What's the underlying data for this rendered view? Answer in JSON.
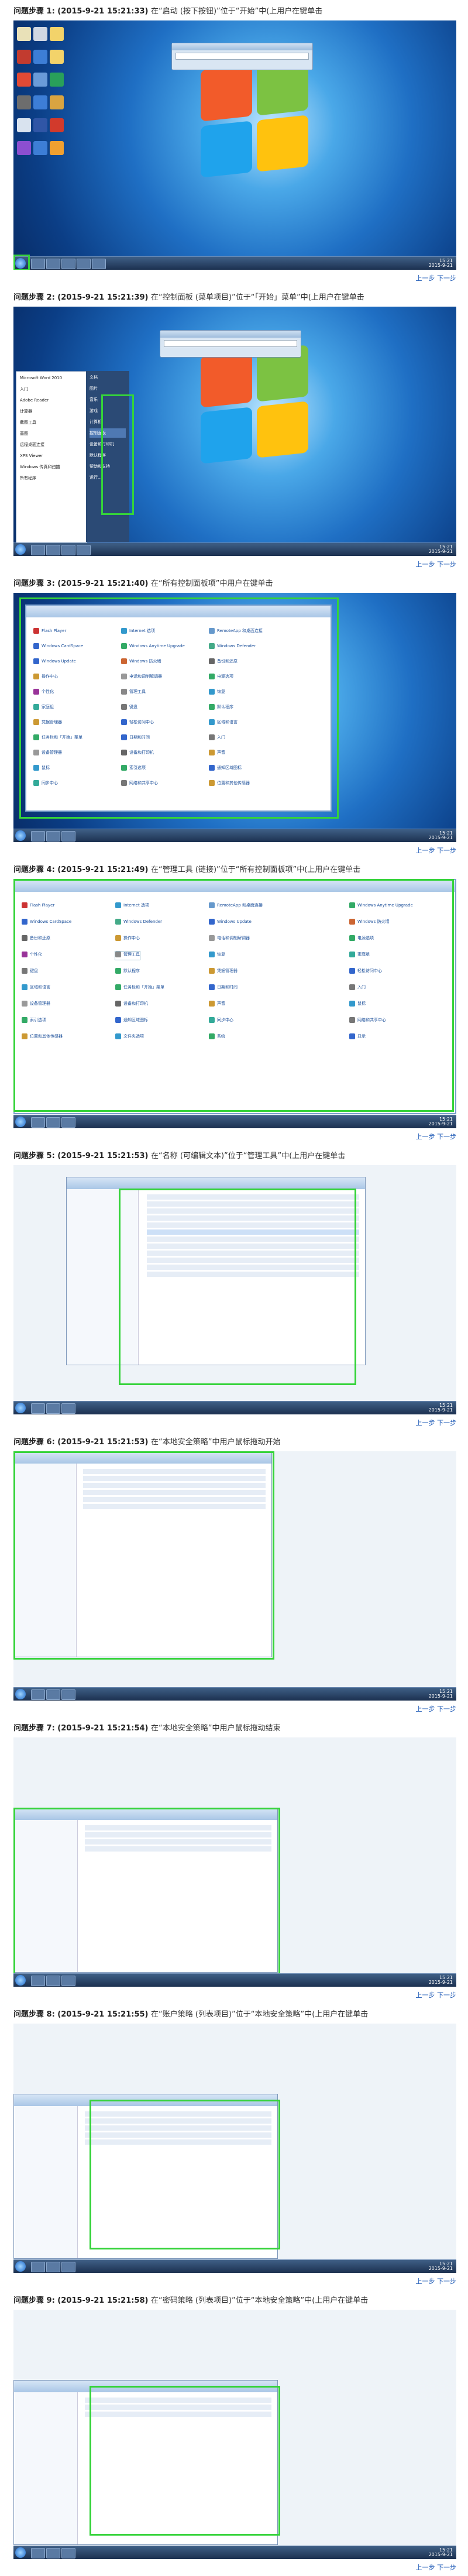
{
  "top_link": "上一步 下一步",
  "steps": [
    {
      "title": "问题步骤 1: (2015-9-21 15:21:33)",
      "desc": "在“启动 (按下按钮)”位于“开始”中(上用户在键单击"
    },
    {
      "title": "问题步骤 2: (2015-9-21 15:21:39)",
      "desc": "在“控制面板 (菜单项目)”位于“「开始」菜单”中(上用户在键单击"
    },
    {
      "title": "问题步骤 3: (2015-9-21 15:21:40)",
      "desc": "在“所有控制面板项”中用户在键单击"
    },
    {
      "title": "问题步骤 4: (2015-9-21 15:21:49)",
      "desc": "在“管理工具 (链接)”位于“所有控制面板项”中(上用户在键单击"
    },
    {
      "title": "问题步骤 5: (2015-9-21 15:21:53)",
      "desc": "在“名称 (可编辑文本)”位于“管理工具”中(上用户在键单击"
    },
    {
      "title": "问题步骤 6: (2015-9-21 15:21:53)",
      "desc": "在“本地安全策略”中用户鼠标拖动开始"
    },
    {
      "title": "问题步骤 7: (2015-9-21 15:21:54)",
      "desc": "在“本地安全策略”中用户鼠标拖动结束"
    },
    {
      "title": "问题步骤 8: (2015-9-21 15:21:55)",
      "desc": "在“账户策略 (列表项目)”位于“本地安全策略”中(上用户在键单击"
    },
    {
      "title": "问题步骤 9: (2015-9-21 15:21:58)",
      "desc": "在“密码策略 (列表项目)”位于“本地安全策略”中(上用户在键单击"
    }
  ],
  "clock": {
    "time": "15:21",
    "date": "2015-9-21"
  },
  "control_panel_items": [
    "Flash Player",
    "Internet 选项",
    "RemoteApp 和桌面连接",
    "Windows CardSpace",
    "Windows Defender",
    "Windows Update",
    "Windows 防火墙",
    "备份和还原",
    "操作中心",
    "电话和调制解调器",
    "电源选项",
    "个性化",
    "管理工具",
    "恢复",
    "家庭组",
    "键盘",
    "默认程序",
    "凭据管理器",
    "轻松访问中心",
    "区域和语言",
    "任务栏和「开始」菜单",
    "日期和时间",
    "入门",
    "设备管理器",
    "设备和打印机",
    "声音",
    "鼠标",
    "索引选项",
    "通知区域图标",
    "同步中心",
    "网络和共享中心",
    "位置和其他传感器",
    "文件夹选项",
    "系统",
    "显示",
    "性能信息和工具",
    "颜色管理",
    "疑难解答",
    "用户帐户",
    "桌面小工具",
    "自动播放",
    "字体",
    "Windows Anytime Upgrade"
  ],
  "start_menu_items": [
    "Microsoft Word 2010",
    "入门",
    "Adobe Reader",
    "计算器",
    "截图工具",
    "画图",
    "远程桌面连接",
    "XPS Viewer",
    "Windows 传真和扫描",
    "所有程序"
  ],
  "start_menu_right": [
    "文档",
    "图片",
    "音乐",
    "游戏",
    "计算机",
    "控制面板",
    "设备和打印机",
    "默认程序",
    "帮助和支持",
    "运行..."
  ]
}
